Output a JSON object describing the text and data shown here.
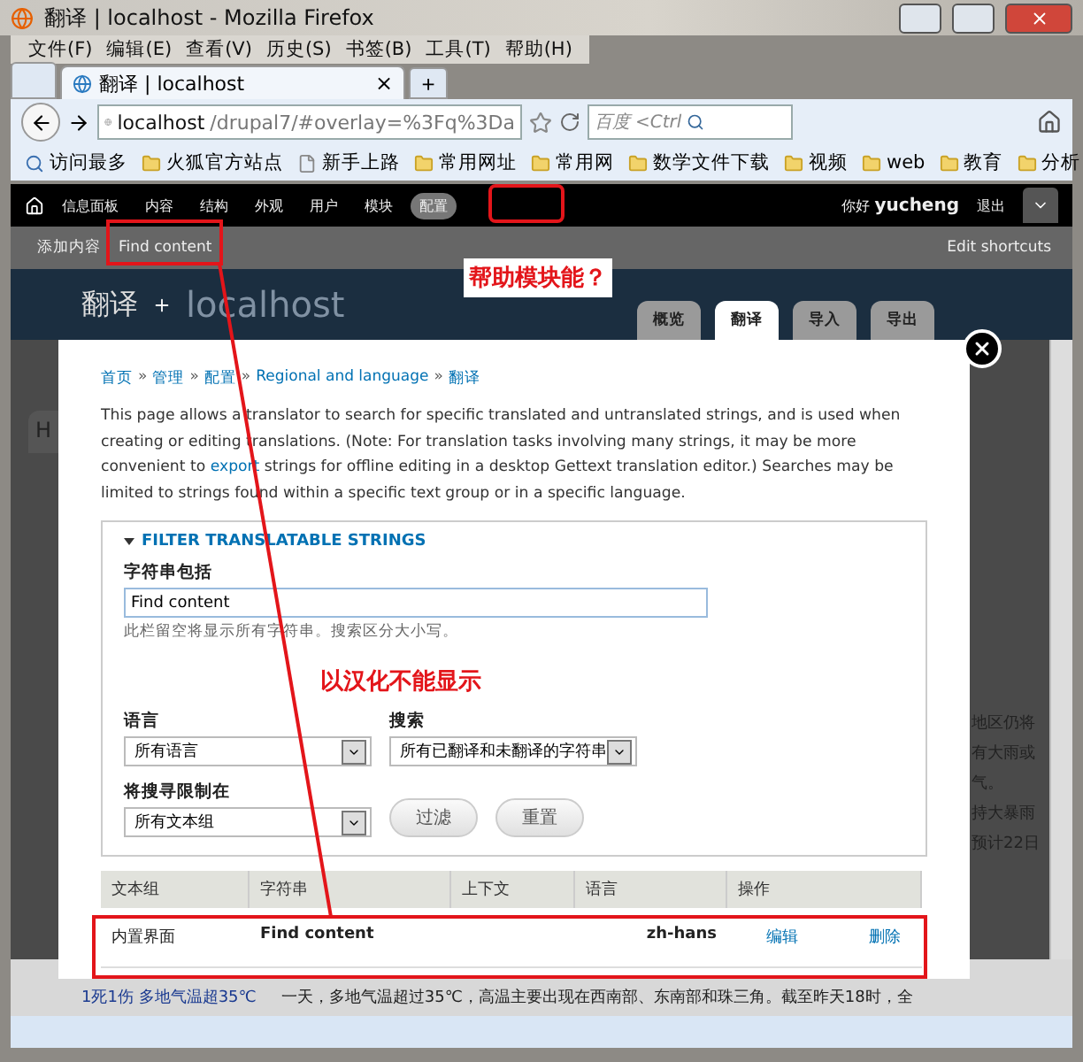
{
  "window": {
    "title": "翻译 | localhost - Mozilla Firefox"
  },
  "menu": [
    "文件(F)",
    "编辑(E)",
    "查看(V)",
    "历史(S)",
    "书签(B)",
    "工具(T)",
    "帮助(H)"
  ],
  "browser_tab": {
    "title": "翻译 | localhost",
    "close": "×",
    "new_tab": "+"
  },
  "address_bar": {
    "host": "localhost",
    "path": "/drupal7/#overlay=%3Fq%3Da"
  },
  "search_field": {
    "engine": "百度",
    "placeholder": "<Ctrl"
  },
  "bookmarks": [
    {
      "label": "访问最多",
      "kind": "smart"
    },
    {
      "label": "火狐官方站点",
      "kind": "folder"
    },
    {
      "label": "新手上路",
      "kind": "page"
    },
    {
      "label": "常用网址",
      "kind": "folder"
    },
    {
      "label": "常用网",
      "kind": "folder"
    },
    {
      "label": "数学文件下载",
      "kind": "folder"
    },
    {
      "label": "视频",
      "kind": "folder"
    },
    {
      "label": "web",
      "kind": "folder"
    },
    {
      "label": "教育",
      "kind": "folder"
    },
    {
      "label": "分析",
      "kind": "folder"
    }
  ],
  "admin_toolbar": {
    "items": [
      {
        "label": "信息面板",
        "selected": false
      },
      {
        "label": "内容",
        "selected": false
      },
      {
        "label": "结构",
        "selected": false
      },
      {
        "label": "外观",
        "selected": false
      },
      {
        "label": "用户",
        "selected": false
      },
      {
        "label": "模块",
        "selected": false
      },
      {
        "label": "配置",
        "selected": true
      }
    ],
    "greeting": "你好",
    "user": "yucheng",
    "logout": "退出"
  },
  "shortcuts": {
    "items": [
      "添加内容",
      "Find content"
    ],
    "edit": "Edit shortcuts"
  },
  "header": {
    "title": "翻译",
    "site_name": "localhost",
    "tabs": [
      {
        "label": "概览",
        "selected": false
      },
      {
        "label": "翻译",
        "selected": true
      },
      {
        "label": "导入",
        "selected": false
      },
      {
        "label": "导出",
        "selected": false
      }
    ]
  },
  "background": {
    "tab": "H",
    "fragments": [
      "地区仍将",
      "有大雨或",
      "气。",
      "持大暴雨",
      "预计22日"
    ],
    "link": "1死1伤 多地气温超35℃",
    "sentence": "一天，多地气温超过35℃，高温主要出现在西南部、东南部和珠三角。截至昨天18时，全"
  },
  "modal": {
    "breadcrumb": [
      "首页",
      "管理",
      "配置",
      "Regional and language",
      "翻译"
    ],
    "separator": "»",
    "description": {
      "before": "This page allows a translator to search for specific translated and untranslated strings, and is used when creating or editing translations. (Note: For translation tasks involving many strings, it may be more convenient to ",
      "link": "export",
      "after": " strings for offline editing in a desktop Gettext translation editor.) Searches may be limited to strings found within a specific text group or in a specific language."
    },
    "fieldset": {
      "legend": "FILTER TRANSLATABLE STRINGS",
      "expanded": true,
      "string_field": {
        "label": "字符串包括",
        "value": "Find content",
        "help": "此栏留空将显示所有字符串。搜索区分大小写。"
      },
      "selects": [
        {
          "label": "语言",
          "value": "所有语言"
        },
        {
          "label": "搜索",
          "value": "所有已翻译和未翻译的字符串"
        },
        {
          "label": "将搜寻限制在",
          "value": "所有文本组"
        }
      ],
      "buttons": [
        "过滤",
        "重置"
      ]
    },
    "table": {
      "columns": [
        "文本组",
        "字符串",
        "上下文",
        "语言",
        "操作"
      ],
      "rows": [
        {
          "group": "内置界面",
          "string": "Find content",
          "language": "zh-hans",
          "edit": "编辑",
          "delete": "删除"
        }
      ]
    }
  },
  "annotations": [
    "帮助模块能？",
    "以汉化不能显示"
  ]
}
